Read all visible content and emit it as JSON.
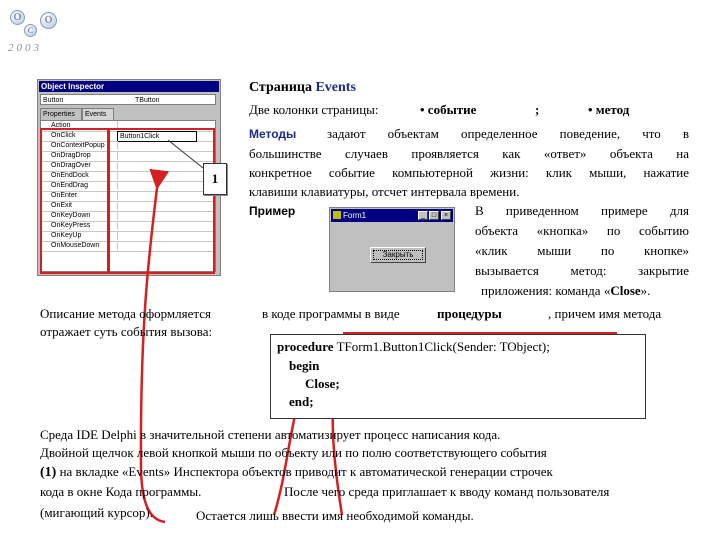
{
  "logo": {
    "letters": [
      "O",
      "C",
      "O"
    ],
    "year": "2003"
  },
  "inspector": {
    "title": "Object Inspector",
    "object_name": "Button",
    "object_type": "TButton",
    "tabs": [
      "Properties",
      "Events"
    ],
    "events": [
      {
        "name": "Action",
        "value": ""
      },
      {
        "name": "OnClick",
        "value": "Button1Click"
      },
      {
        "name": "OnContextPopup",
        "value": ""
      },
      {
        "name": "OnDragDrop",
        "value": ""
      },
      {
        "name": "OnDragOver",
        "value": ""
      },
      {
        "name": "OnEndDock",
        "value": ""
      },
      {
        "name": "OnEndDrag",
        "value": ""
      },
      {
        "name": "OnEnter",
        "value": ""
      },
      {
        "name": "OnExit",
        "value": ""
      },
      {
        "name": "OnKeyDown",
        "value": ""
      },
      {
        "name": "OnKeyPress",
        "value": ""
      },
      {
        "name": "OnKeyUp",
        "value": ""
      },
      {
        "name": "OnMouseDown",
        "value": ""
      }
    ],
    "badge": "1"
  },
  "heading": {
    "prefix": "Страница",
    "name": "Events"
  },
  "paragraph1": {
    "line1_a": "Две колонки страницы:",
    "line1_b": "• событие",
    "line1_c": ";",
    "line1_d": "• метод",
    "line2_bold": "Методы",
    "line2_rest": "задают объектам определенное поведение, что в",
    "line3": "большинстве случаев проявляется как «ответ» объекта на",
    "line4": "конкретное событие компьютерной жизни: клик мыши, нажатие",
    "line5": "клавиши клавиатуры, отсчет интервала времени."
  },
  "example": {
    "label": "Пример",
    "lines": [
      "В приведенном примере для",
      "объекта «кнопка» по событию",
      "«клик мыши по кнопке»",
      "вызывается метод: закрытие"
    ],
    "last_line_prefix": "приложения: команда «",
    "last_line_bold": "Close",
    "last_line_suffix": "»."
  },
  "form": {
    "title": "Form1",
    "button_label": "Закрыть",
    "min": "_",
    "max": "□",
    "close": "×"
  },
  "paragraph2": {
    "line1_a": "Описание метода оформляется",
    "line1_b": "в коде программы в виде",
    "line1_bold": "процедуры",
    "line1_c": ", причем имя метода",
    "line2": "отражает суть события вызова:"
  },
  "code": {
    "line1_kw": "procedure",
    "line1_rest": "TForm1.Button1Click(Sender: TObject);",
    "line2": "begin",
    "line3": "Close;",
    "line4": "end;"
  },
  "paragraph3": {
    "line1": "Среда IDE Delphi в значительной степени автоматизирует процесс написания кода.",
    "line2": "Двойной щелчок левой кнопкой мыши по объекту или по полю соответствующего события",
    "line3_num": "(1)",
    "line3_rest": "на вкладке «Events» Инспектора объектов приводит к автоматической генерации строчек",
    "line4_a": "кода в окне Кода программы.",
    "line4_b": "После чего среда приглашает к вводу команд пользователя",
    "line5_a": "(мигающий курсор).",
    "line5_b": "Остается лишь ввести имя необходимой команды."
  },
  "colors": {
    "accent_red": "#d42020",
    "heading_blue": "#1a2b8a",
    "title_bar": "#000080"
  }
}
